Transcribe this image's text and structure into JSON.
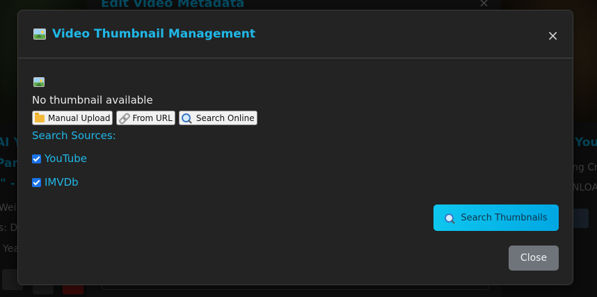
{
  "modal": {
    "title": "Video Thumbnail Management",
    "close_glyph": "×",
    "thumbnail_icon": "picture-icon",
    "no_thumbnail_text": "No thumbnail available",
    "source_buttons": [
      {
        "label": "Manual Upload",
        "icon": "folder-icon"
      },
      {
        "label": "From URL",
        "icon": "link-icon"
      },
      {
        "label": "Search Online",
        "icon": "search-icon"
      }
    ],
    "search_sources_label": "Search Sources:",
    "sources": [
      {
        "label": "YouTube",
        "checked": true
      },
      {
        "label": "IMVDb",
        "checked": true
      }
    ],
    "search_button_label": "Search Thumbnails",
    "close_button_label": "Close"
  },
  "background": {
    "edit_title": "Edit Video Metadata",
    "edit_close": "×",
    "left_card": {
      "title_1": "AI Y",
      "title_2": "Para",
      "title_3": "\" -",
      "text_1": "Wei",
      "text_2": "s: D",
      "text_3": "Yea"
    },
    "right_card": {
      "title_1": "You",
      "text_1": "ng Cr",
      "text_2": "NLOA"
    }
  },
  "colors": {
    "accent": "#20b8e8",
    "modal_bg": "#232323",
    "search_button": "#00b9ea",
    "close_button": "#6f747a"
  }
}
